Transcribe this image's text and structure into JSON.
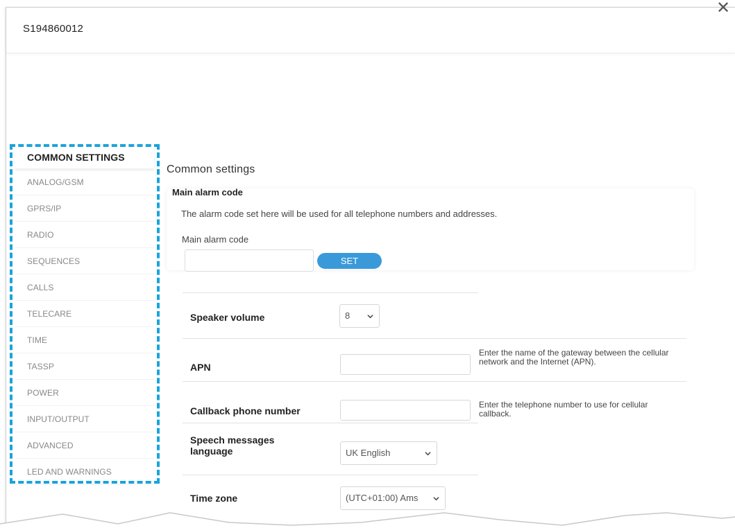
{
  "window": {
    "title": "S194860012",
    "close_icon": "close-icon"
  },
  "sidebar": {
    "items": [
      {
        "label": "COMMON SETTINGS",
        "active": true
      },
      {
        "label": "ANALOG/GSM"
      },
      {
        "label": "GPRS/IP"
      },
      {
        "label": "RADIO"
      },
      {
        "label": "SEQUENCES"
      },
      {
        "label": "CALLS"
      },
      {
        "label": "TELECARE"
      },
      {
        "label": "TIME"
      },
      {
        "label": "TASSP"
      },
      {
        "label": "POWER"
      },
      {
        "label": "INPUT/OUTPUT"
      },
      {
        "label": "ADVANCED"
      },
      {
        "label": "LED AND WARNINGS"
      }
    ]
  },
  "main": {
    "title": "Common settings",
    "alarm_section": {
      "heading": "Main alarm code",
      "description": "The alarm code set here will be used for all telephone numbers and addresses.",
      "field_label": "Main alarm code",
      "field_value": "",
      "set_label": "SET"
    },
    "settings": {
      "speaker_volume": {
        "label": "Speaker volume",
        "value": "8"
      },
      "apn": {
        "label": "APN",
        "value": "",
        "help": "Enter the name of the gateway between the cellular network and the Internet (APN)."
      },
      "callback": {
        "label": "Callback phone number",
        "value": "",
        "help": "Enter the telephone number to use for cellular callback."
      },
      "language": {
        "label": "Speech messages language",
        "value": "UK English"
      },
      "timezone": {
        "label": "Time zone",
        "value": "(UTC+01:00) Ams"
      }
    }
  },
  "colors": {
    "accent": "#3a9ad9",
    "highlight_border": "#1aa3dc"
  }
}
